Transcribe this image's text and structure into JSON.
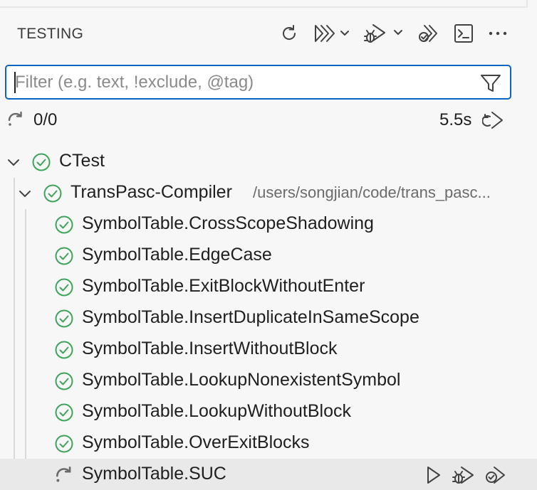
{
  "panel": {
    "title": "TESTING",
    "toolbar": [
      "refresh-icon",
      "run-all-icon",
      "debug-all-icon",
      "run-with-coverage-icon",
      "terminal-icon",
      "more-actions-icon"
    ]
  },
  "filter": {
    "placeholder": "Filter (e.g. text, !exclude, @tag)",
    "value": ""
  },
  "status": {
    "count": "0/0",
    "duration": "5.5s"
  },
  "tree": {
    "root": {
      "label": "CTest",
      "state": "passed",
      "expanded": true
    },
    "group": {
      "label": "TransPasc-Compiler",
      "path": "/users/songjian/code/trans_pasc...",
      "state": "passed",
      "expanded": true
    },
    "tests": [
      {
        "label": "SymbolTable.CrossScopeShadowing",
        "state": "passed"
      },
      {
        "label": "SymbolTable.EdgeCase",
        "state": "passed"
      },
      {
        "label": "SymbolTable.ExitBlockWithoutEnter",
        "state": "passed"
      },
      {
        "label": "SymbolTable.InsertDuplicateInSameScope",
        "state": "passed"
      },
      {
        "label": "SymbolTable.InsertWithoutBlock",
        "state": "passed"
      },
      {
        "label": "SymbolTable.LookupNonexistentSymbol",
        "state": "passed"
      },
      {
        "label": "SymbolTable.LookupWithoutBlock",
        "state": "passed"
      },
      {
        "label": "SymbolTable.OverExitBlocks",
        "state": "passed"
      },
      {
        "label": "SymbolTable.SUC",
        "state": "running"
      }
    ]
  },
  "colors": {
    "passed": "#3fa45b",
    "running": "#6b6b6b",
    "accent": "#0a66c2",
    "icon": "#424242"
  }
}
